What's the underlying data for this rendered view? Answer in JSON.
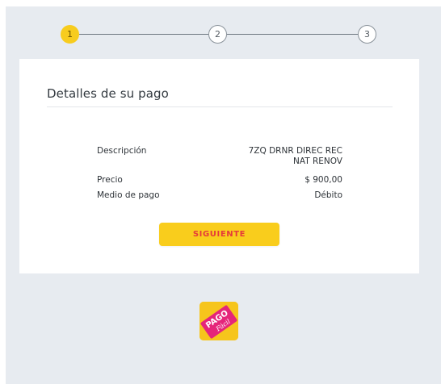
{
  "stepper": {
    "steps": [
      {
        "number": "1"
      },
      {
        "number": "2"
      },
      {
        "number": "3"
      }
    ]
  },
  "card": {
    "title": "Detalles de su pago",
    "rows": [
      {
        "label": "Descripción",
        "value_line1": "7ZQ DRNR DIREC REC",
        "value_line2": "NAT RENOV"
      },
      {
        "label": "Precio",
        "value": "$ 900,00"
      },
      {
        "label": "Medio de pago",
        "value": "Débito"
      }
    ],
    "next_button_label": "SIGUIENTE"
  },
  "logo": {
    "text_top": "PAGO",
    "text_bottom": "Fácil"
  },
  "colors": {
    "background": "#e7ebf0",
    "accent_yellow": "#f9cd1c",
    "button_text": "#e53a3a",
    "logo_magenta": "#e5257a"
  }
}
